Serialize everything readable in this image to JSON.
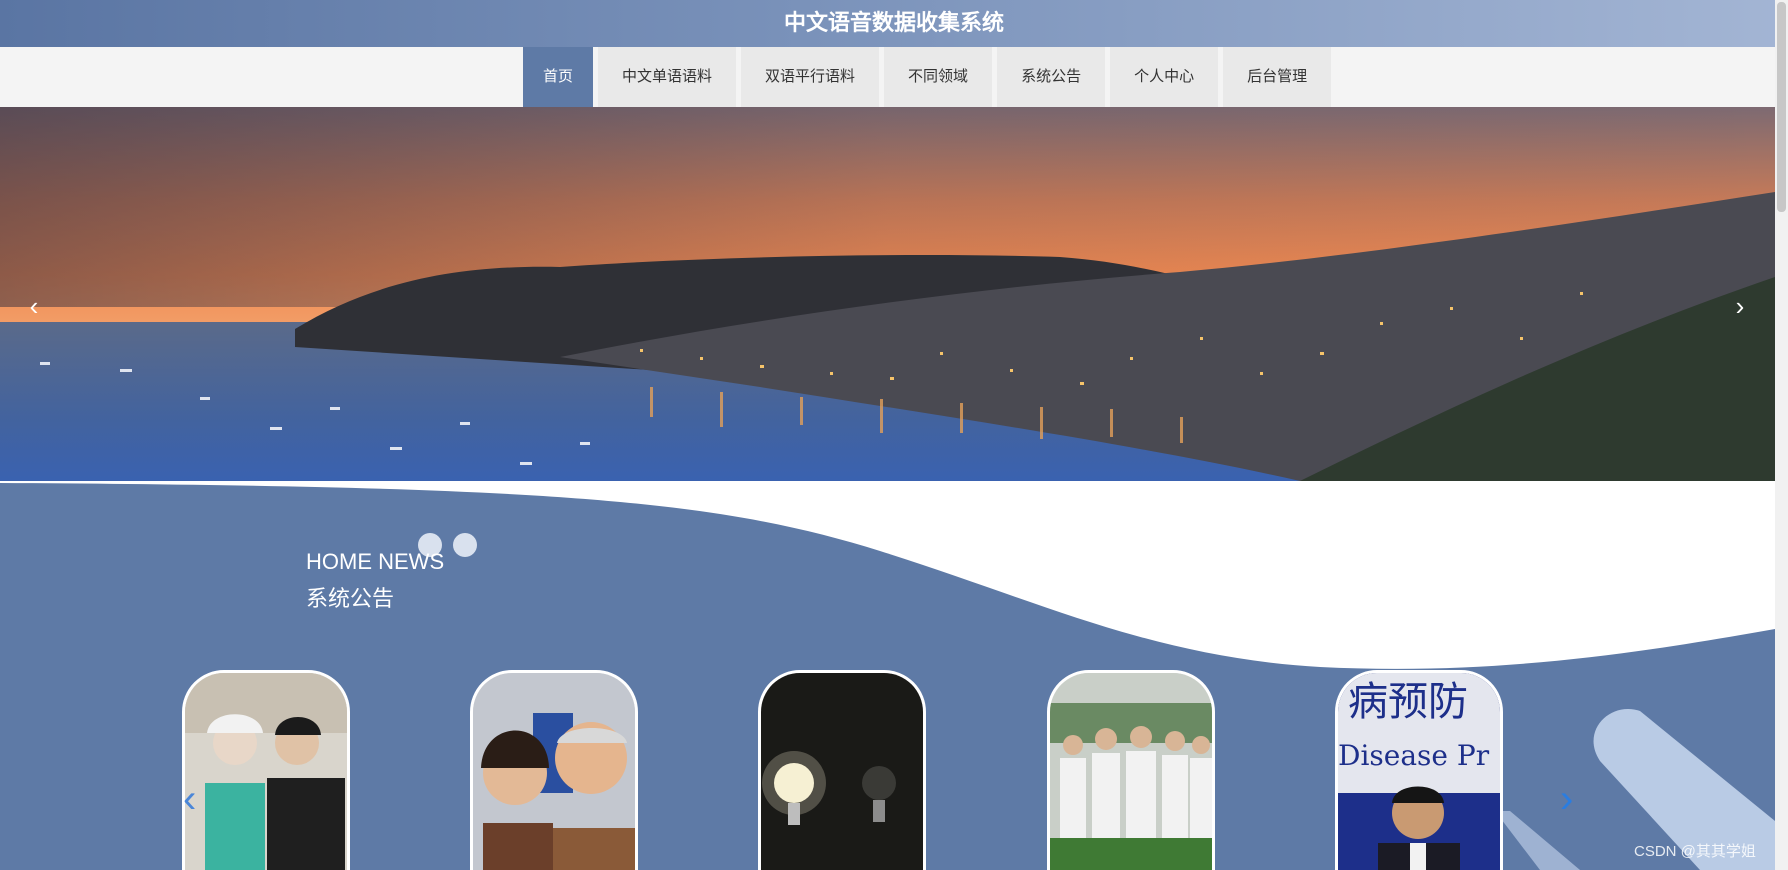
{
  "app": {
    "title": "中文语音数据收集系统"
  },
  "nav": {
    "items": [
      {
        "label": "首页",
        "active": true
      },
      {
        "label": "中文单语语料"
      },
      {
        "label": "双语平行语料"
      },
      {
        "label": "不同领域"
      },
      {
        "label": "系统公告"
      },
      {
        "label": "个人中心"
      },
      {
        "label": "后台管理"
      }
    ]
  },
  "banner": {
    "prev_icon": "chevron-left-icon",
    "next_icon": "chevron-right-icon"
  },
  "news": {
    "title_en": "HOME NEWS",
    "title_cn": "系统公告",
    "prev_icon": "chevron-left-icon",
    "next_icon": "chevron-right-icon"
  },
  "watermark": "CSDN @其其学姐",
  "colors": {
    "primary": "#5e7aa6",
    "nav_bg": "#f4f4f4",
    "nav_item_bg": "#e9e9e9"
  }
}
